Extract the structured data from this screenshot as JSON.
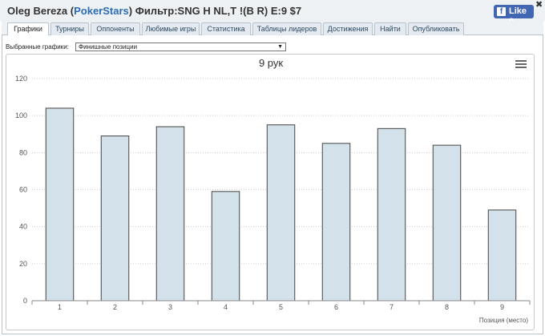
{
  "header": {
    "player": "Oleg Bereza",
    "room_open": " (",
    "room": "PokerStars",
    "room_close": ")",
    "filter": " Фильтр:SNG H NL,T !(B R) E:9 $7",
    "fb_like_label": "Like 0",
    "fb_icon": "f",
    "close_icon": "✖"
  },
  "tabs": [
    {
      "label": "Графики",
      "active": true
    },
    {
      "label": "Турниры"
    },
    {
      "label": "Оппоненты"
    },
    {
      "label": "Любимые игры"
    },
    {
      "label": "Статистика"
    },
    {
      "label": "Таблицы лидеров"
    },
    {
      "label": "Достижения"
    },
    {
      "label": "Найти"
    },
    {
      "label": "Опубликовать"
    }
  ],
  "selector": {
    "label": "Выбранные графики:",
    "value": "Финишные позиции",
    "arrow": "▼"
  },
  "colors": {
    "bar_fill": "#d3e1eb",
    "bar_stroke": "#444444",
    "grid": "#cccccc"
  },
  "chart_data": {
    "type": "bar",
    "title": "9 рук",
    "xlabel": "Позиция (место)",
    "ylabel": "",
    "categories": [
      "1",
      "2",
      "3",
      "4",
      "5",
      "6",
      "7",
      "8",
      "9"
    ],
    "values": [
      104,
      89,
      94,
      59,
      95,
      85,
      93,
      84,
      49
    ],
    "ylim": [
      0,
      120
    ],
    "yticks": [
      0,
      20,
      40,
      60,
      80,
      100,
      120
    ],
    "grid": true,
    "legend": "none"
  }
}
